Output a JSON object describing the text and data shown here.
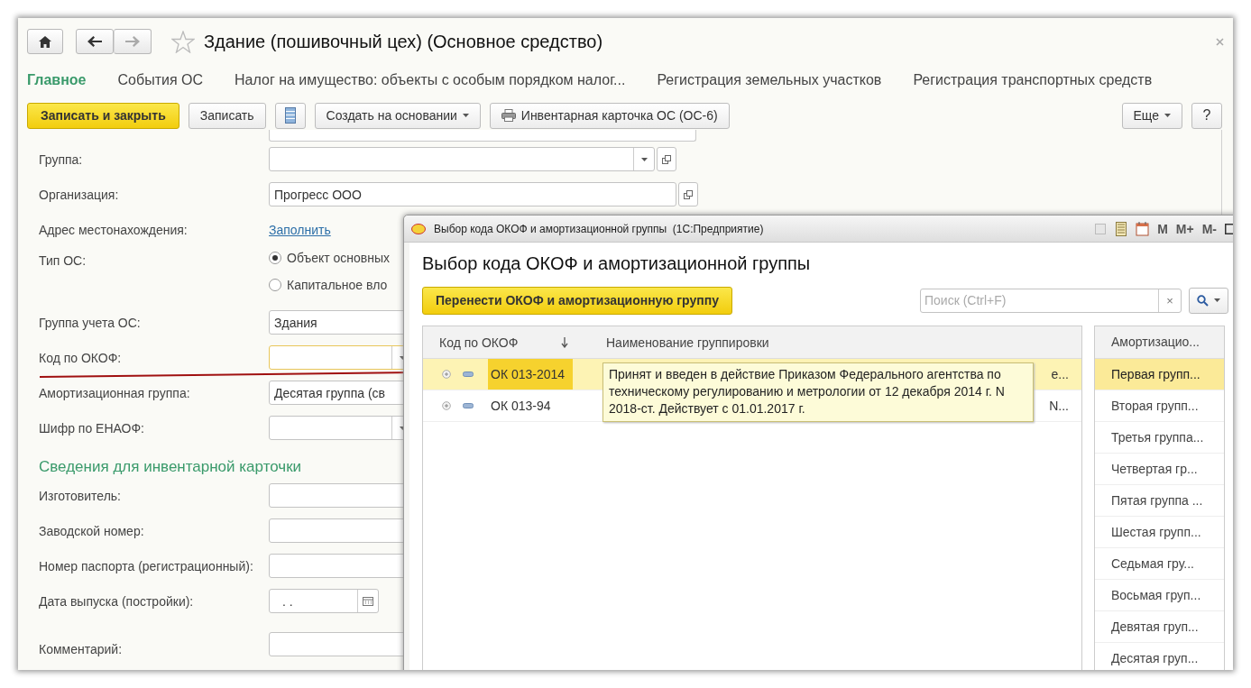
{
  "window": {
    "title": "Здание (пошивочный цех) (Основное средство)"
  },
  "tabs": [
    {
      "label": "Главное",
      "selected": true
    },
    {
      "label": "События ОС",
      "selected": false
    },
    {
      "label": "Налог на имущество: объекты с особым порядком налог...",
      "selected": false
    },
    {
      "label": "Регистрация земельных участков",
      "selected": false
    },
    {
      "label": "Регистрация транспортных средств",
      "selected": false
    }
  ],
  "toolbar": [
    {
      "kind": "primary",
      "label": "Записать и закрыть"
    },
    {
      "kind": "button",
      "label": "Записать"
    },
    {
      "kind": "icon"
    },
    {
      "kind": "menu",
      "label": "Создать на основании"
    },
    {
      "kind": "print",
      "label": "Инвентарная карточка ОС (ОС-6)"
    }
  ],
  "toolbar_right": [
    {
      "kind": "menu",
      "label": "Еще"
    },
    {
      "kind": "button",
      "label": "?"
    }
  ],
  "form": [
    {
      "kind": "select-open",
      "label": "Группа:"
    },
    {
      "kind": "open",
      "label": "Организация:",
      "value": "Прогресс ООО"
    },
    {
      "kind": "link",
      "label": "Адрес местонахождения:",
      "value": "Заполнить"
    },
    {
      "kind": "radio",
      "label": "Тип ОС:",
      "options": [
        {
          "label": "Объект основных",
          "selected": true
        },
        {
          "label": "Капитальное вло",
          "selected": false
        }
      ]
    },
    {
      "kind": "text",
      "label": "Группа учета ОС:",
      "value": "Здания"
    },
    {
      "kind": "select",
      "label": "Код по ОКОФ:",
      "focused": true
    },
    {
      "kind": "text",
      "label": "Амортизационная группа:",
      "value": "Десятая группа (св"
    },
    {
      "kind": "select",
      "label": "Шифр по ЕНАОФ:",
      "focused": false
    },
    {
      "kind": "section",
      "label": "Сведения для инвентарной карточки"
    },
    {
      "kind": "text",
      "label": "Изготовитель:"
    },
    {
      "kind": "text",
      "label": "Заводской номер:"
    },
    {
      "kind": "text",
      "label": "Номер паспорта (регистрационный):"
    },
    {
      "kind": "date",
      "label": "Дата выпуска (постройки):",
      "value": ".  ."
    },
    {
      "kind": "text",
      "label": "Комментарий:"
    }
  ],
  "dialog": {
    "title": "Выбор кода ОКОФ и амортизационной группы  (1С:Предприятие)",
    "title_buttons": [
      "M",
      "M+",
      "M-"
    ],
    "heading": "Выбор кода ОКОФ и амортизационной группы",
    "button": "Перенести ОКОФ и амортизационную группу",
    "search": {
      "placeholder": "Поиск (Ctrl+F)",
      "clear": "×"
    },
    "table": {
      "columns": [
        "Код по ОКОФ",
        "Наименование группировки"
      ],
      "rows": [
        {
          "code": "ОК 013-2014",
          "name": "е...",
          "selected": true
        },
        {
          "code": "ОК 013-94",
          "name": "N...",
          "selected": false
        }
      ]
    },
    "tooltip": "Принят и введен в действие Приказом Федерального агентства по техническому регулированию и метрологии от 12 декабря 2014 г. N 2018-ст. Действует с 01.01.2017 г.",
    "groups": {
      "column": "Амортизацио...",
      "rows": [
        {
          "label": "Первая групп...",
          "selected": true
        },
        {
          "label": "Вторая групп...",
          "selected": false
        },
        {
          "label": "Третья группа...",
          "selected": false
        },
        {
          "label": "Четвертая гр...",
          "selected": false
        },
        {
          "label": "Пятая группа ...",
          "selected": false
        },
        {
          "label": "Шестая групп...",
          "selected": false
        },
        {
          "label": "Седьмая гру...",
          "selected": false
        },
        {
          "label": "Восьмая груп...",
          "selected": false
        },
        {
          "label": "Девятая груп...",
          "selected": false
        },
        {
          "label": "Десятая груп...",
          "selected": false
        }
      ]
    }
  }
}
